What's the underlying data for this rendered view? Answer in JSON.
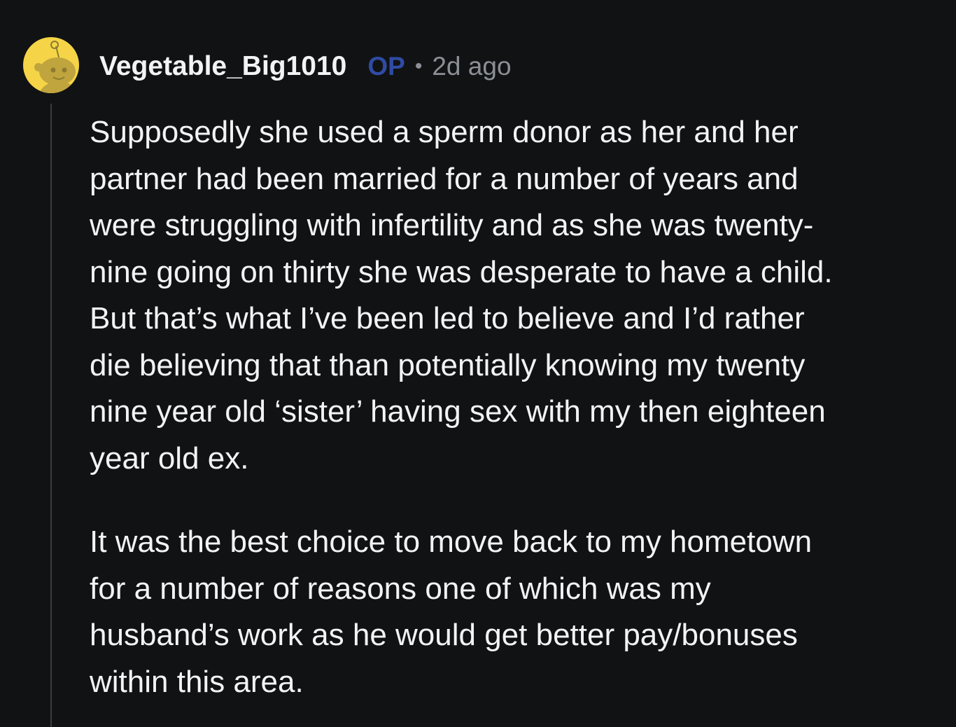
{
  "comment": {
    "author": "Vegetable_Big1010",
    "op_badge": "OP",
    "separator": "•",
    "timestamp": "2d ago",
    "avatar": {
      "icon": "reddit-snoo-avatar",
      "background_color": "#f5d547",
      "figure_color": "#c0a43d"
    },
    "paragraphs": [
      "Supposedly she used a sperm donor as her and her\npartner had been married for a number of years and\nwere struggling with infertility and as she was twenty-\nnine going on thirty she was desperate to have a child.\nBut that’s what I’ve been led to believe and I’d rather\ndie believing that than potentially knowing my twenty\nnine year old ‘sister’ having sex with my then eighteen\nyear old ex.",
      "It was the best choice to move back to my hometown\nfor a number of reasons one of which was my\nhusband’s work as he would get better pay/bonuses\nwithin this area."
    ]
  },
  "colors": {
    "background": "#111214",
    "text": "#f1f3f5",
    "op_badge": "#2f4ba4",
    "muted": "#8b9095",
    "thread_line": "#3a3d41"
  }
}
